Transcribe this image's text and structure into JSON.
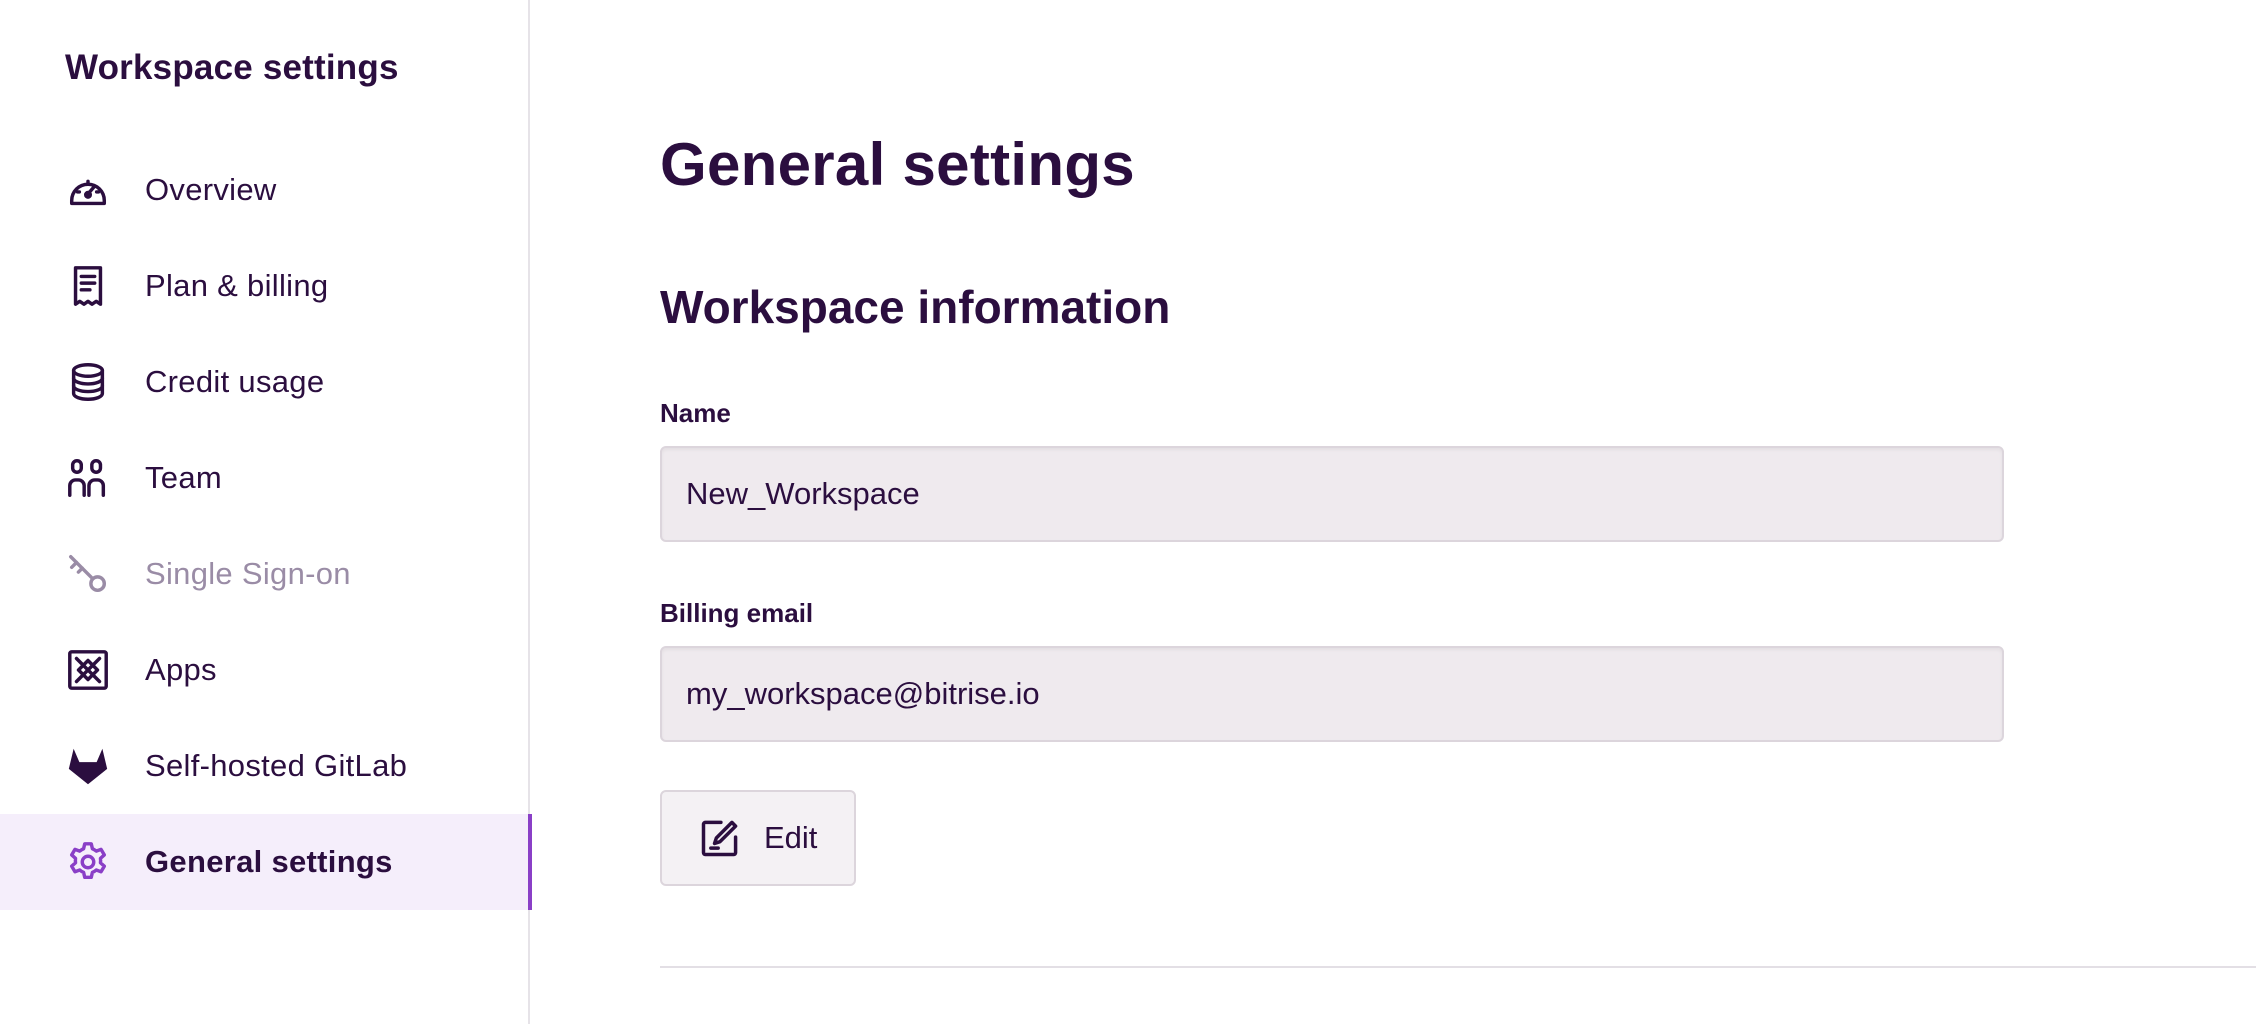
{
  "sidebar": {
    "title": "Workspace settings",
    "items": [
      {
        "label": "Overview",
        "icon": "gauge-icon"
      },
      {
        "label": "Plan & billing",
        "icon": "receipt-icon"
      },
      {
        "label": "Credit usage",
        "icon": "coin-stack-icon"
      },
      {
        "label": "Team",
        "icon": "team-icon"
      },
      {
        "label": "Single Sign-on",
        "icon": "key-icon",
        "disabled": true
      },
      {
        "label": "Apps",
        "icon": "apps-icon"
      },
      {
        "label": "Self-hosted GitLab",
        "icon": "gitlab-icon"
      },
      {
        "label": "General settings",
        "icon": "gear-icon",
        "active": true
      }
    ]
  },
  "main": {
    "title": "General settings",
    "section_title": "Workspace information",
    "name_field": {
      "label": "Name",
      "value": "New_Workspace"
    },
    "email_field": {
      "label": "Billing email",
      "value": "my_workspace@bitrise.io"
    },
    "edit_button": {
      "label": "Edit",
      "icon": "edit-icon"
    }
  },
  "colors": {
    "text": "#2b0e3f",
    "accent": "#8a3fc7",
    "active_bg": "#f5eefb",
    "disabled_text": "#9a8ca6",
    "input_bg": "#efeaee"
  }
}
